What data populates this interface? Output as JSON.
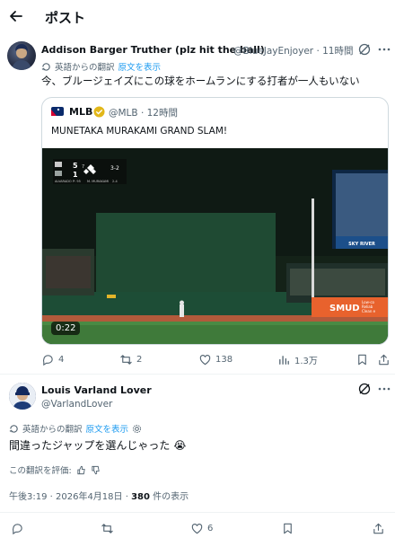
{
  "header": {
    "title": "ポスト"
  },
  "tweet1": {
    "name": "Addison Barger Truther (plz hit the ball)",
    "handle": "@BlueJayEnjoyer",
    "time": "· 11時間",
    "translation_label": "英語からの翻訳",
    "show_original": "原文を表示",
    "text": "今、ブルージェイズにこの球をホームランにする打者が一人もいない",
    "icons": [
      "grok-icon",
      "more-icon",
      "translate-icon"
    ]
  },
  "quote": {
    "name": "MLB",
    "meta": "@MLB · 12時間",
    "text": "MUNETAKA MURAKAMI GRAND SLAM!",
    "video_time": "0:22",
    "scoreboard": {
      "away_runs": "5",
      "home_runs": "1",
      "count": "3-2",
      "inning_label": "7",
      "batter": "M. MURAKAMI",
      "pitcher": "ALVARADO",
      "pitch_count": "P: 95",
      "batter_line": "2-4"
    },
    "scoreboard_sponsor": "SKY RIVER",
    "wall_sign": "SMUD",
    "wall_sign_lines": [
      "Low-co",
      "Reliab",
      "Clean e"
    ]
  },
  "actions1": {
    "replies": "4",
    "reposts": "2",
    "likes": "138",
    "views": "1.3万"
  },
  "tweet2": {
    "name": "Louis Varland Lover",
    "handle": "@VarlandLover",
    "translation_label": "英語からの翻訳",
    "show_original": "原文を表示",
    "text": "間違ったジャップを選んじゃった",
    "emoji": "😭",
    "rate_label": "この翻訳を評価:",
    "timestamp": "午後3:19 · 2026年4月18日 · ",
    "views_count": "380",
    "views_suffix": " 件の表示"
  },
  "actions2": {
    "likes": "6"
  },
  "colors": {
    "accent": "#1d9bf0",
    "muted": "#536471",
    "border": "#cfd9de"
  }
}
